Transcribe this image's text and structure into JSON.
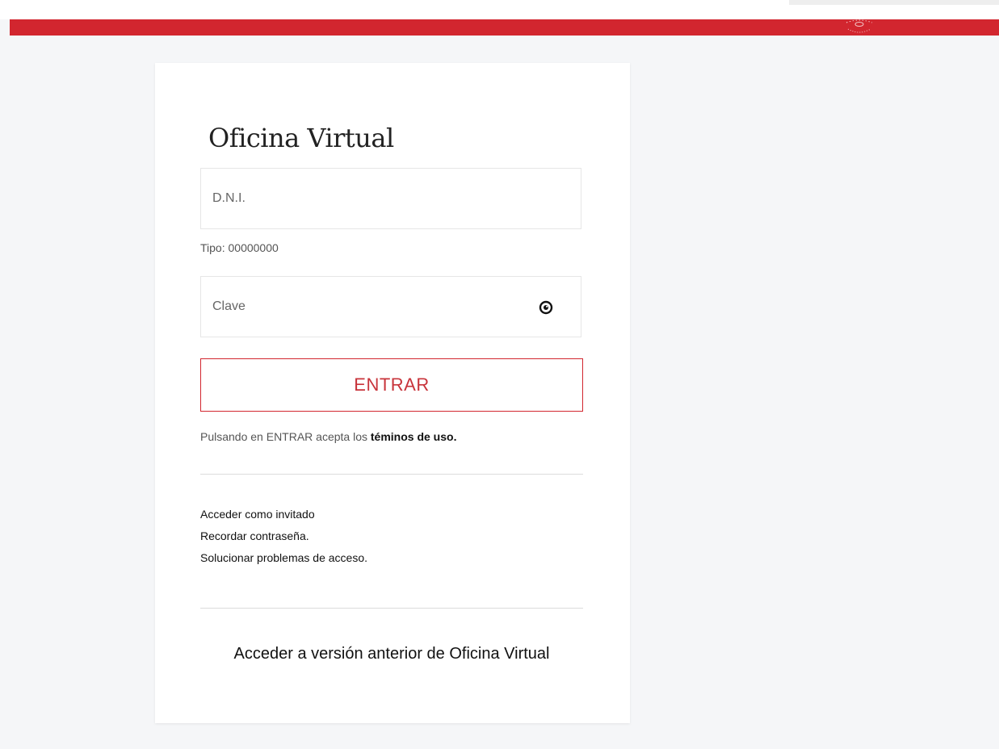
{
  "header": {
    "brand_color": "#d2262f",
    "emblem_icon": "coat-of-arms-icon"
  },
  "login": {
    "title": "Oficina Virtual",
    "dni_placeholder": "D.N.I.",
    "dni_value": "",
    "dni_hint": "Tipo: 00000000",
    "password_placeholder": "Clave",
    "password_value": "",
    "show_password_icon": "eye-icon",
    "submit_label": "ENTRAR",
    "terms_prefix": "Pulsando en ENTRAR acepta los ",
    "terms_link": "téminos de uso."
  },
  "links": {
    "guest": "Acceder como invitado",
    "remember_password": "Recordar contraseña.",
    "access_problems": "Solucionar problemas de acceso."
  },
  "legacy": {
    "label": "Acceder a versión anterior de Oficina Virtual"
  }
}
